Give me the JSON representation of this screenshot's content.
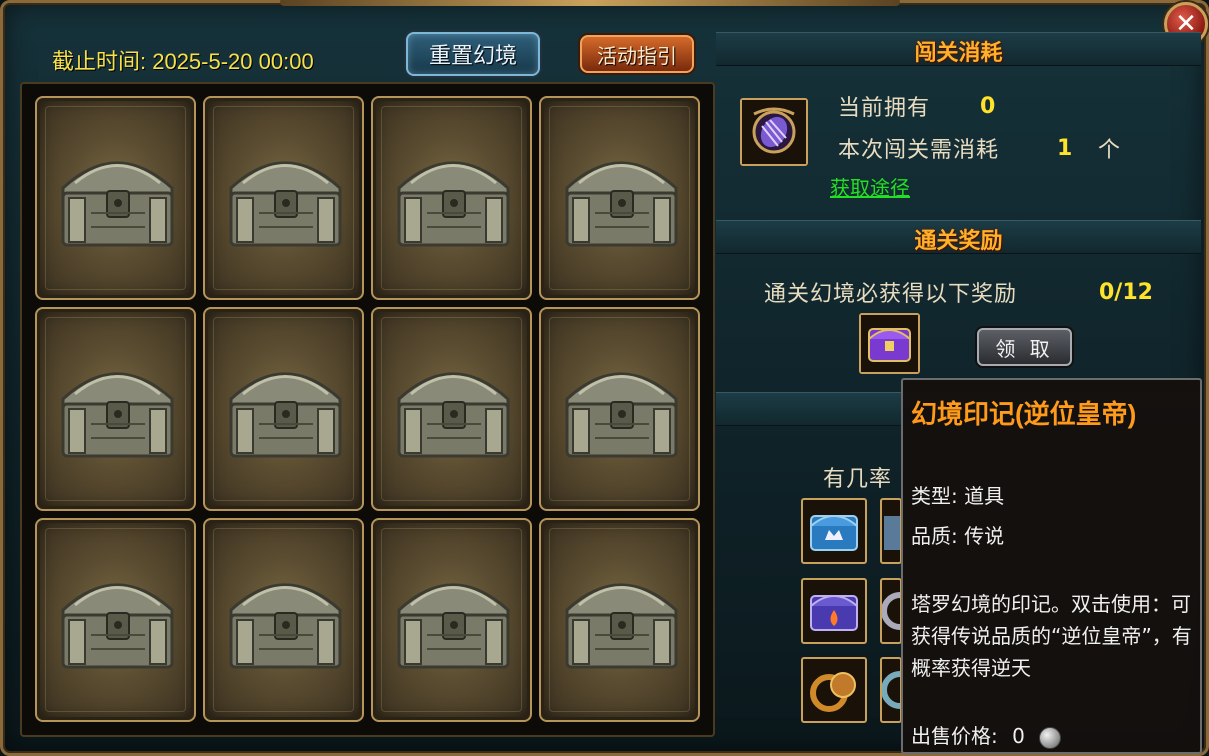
{
  "header": {
    "deadline_text": "截止时间: 2025-5-20 00:00",
    "reset_button": "重置幻境",
    "guide_button": "活动指引",
    "close_icon": "close-icon"
  },
  "grid": {
    "rows": 3,
    "cols": 4,
    "item": "treasure-chest-icon"
  },
  "cost_section": {
    "title": "闯关消耗",
    "owned_label": "当前拥有",
    "owned_value": "0",
    "need_label": "本次闯关需消耗",
    "need_value": "1",
    "need_unit": "个",
    "obtain_link": "获取途径",
    "item_icon": "illusion-mark-icon"
  },
  "reward_section": {
    "title": "通关奖励",
    "desc": "通关幻境必获得以下奖励",
    "progress": "0/12",
    "claim_button": "领 取",
    "reward_icon": "purple-chest-icon"
  },
  "chance_section": {
    "title_visible": "",
    "desc_visible": "有几率",
    "icons": [
      "blue-crown-chest-icon",
      "silver-chest-icon",
      "purple-fire-chest-icon",
      "silver-ring-icon",
      "gold-ring-icon",
      "silver-ring-2-icon"
    ]
  },
  "tooltip": {
    "title": "幻境印记(逆位皇帝)",
    "type_line": "类型: 道具",
    "quality_line": "品质: 传说",
    "description": "塔罗幻境的印记。双击使用：可获得传说品质的“逆位皇帝”，有概率获得逆天",
    "price_label": "出售价格:",
    "price_value": "0",
    "price_icon": "silver-coin-icon"
  },
  "colors": {
    "accent_gold": "#ffb12a",
    "number_yellow": "#ffe22a",
    "link_green": "#22e022",
    "tooltip_title": "#ff9a1a"
  }
}
